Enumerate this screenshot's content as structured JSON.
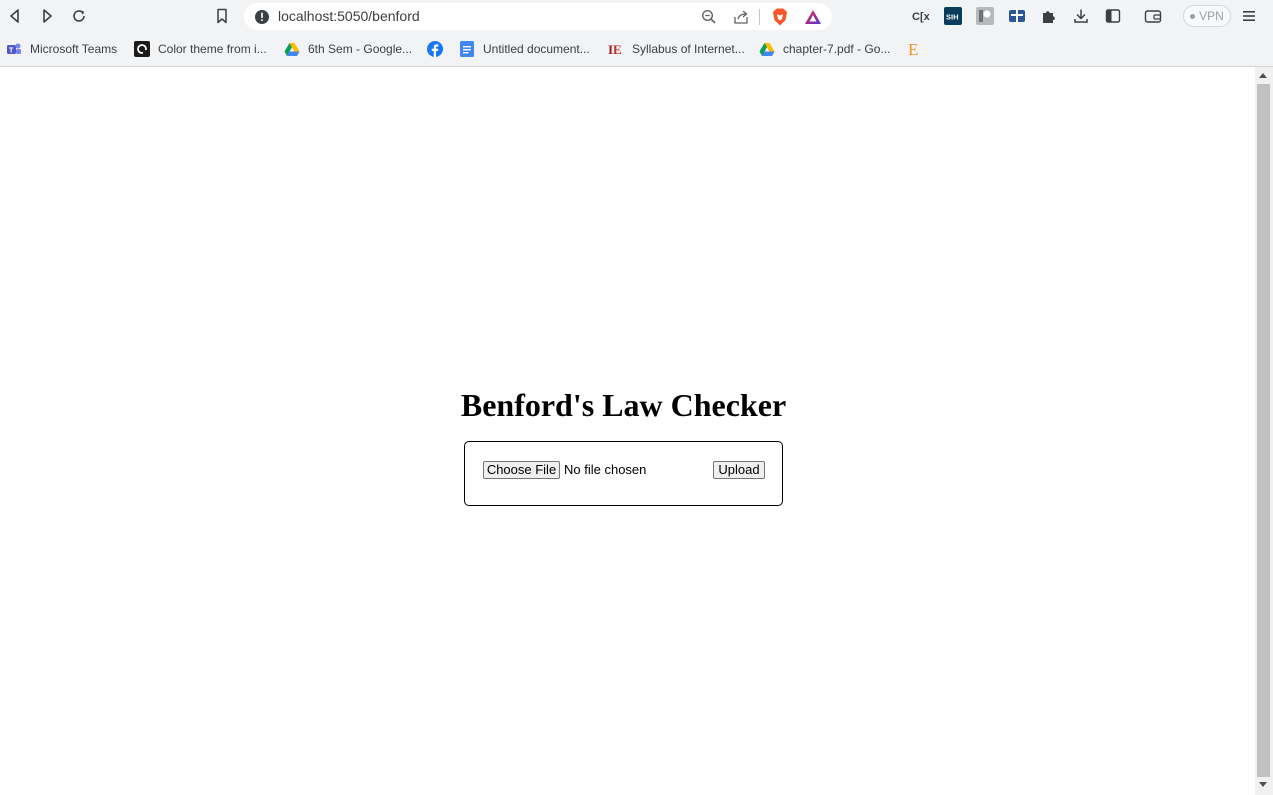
{
  "browser": {
    "url": "localhost:5050/benford",
    "vpn_label": "VPN"
  },
  "bookmarks": [
    {
      "label": "Microsoft Teams",
      "icon": "teams-icon"
    },
    {
      "label": "Color theme from i...",
      "icon": "color-theme-icon"
    },
    {
      "label": "6th Sem - Google...",
      "icon": "google-drive-icon"
    },
    {
      "label": "",
      "icon": "facebook-icon"
    },
    {
      "label": "Untitled document...",
      "icon": "google-docs-icon"
    },
    {
      "label": "Syllabus of Internet...",
      "icon": "ioe-icon"
    },
    {
      "label": "chapter-7.pdf - Go...",
      "icon": "google-drive-icon"
    },
    {
      "label": "",
      "icon": "e-letter-icon"
    }
  ],
  "page": {
    "title": "Benford's Law Checker",
    "choose_file_label": "Choose File",
    "file_status": "No file chosen",
    "upload_label": "Upload"
  },
  "colors": {
    "toolbar_bg": "#f1f3f4",
    "brave_orange": "#fb542b",
    "facebook_blue": "#1877f2"
  }
}
